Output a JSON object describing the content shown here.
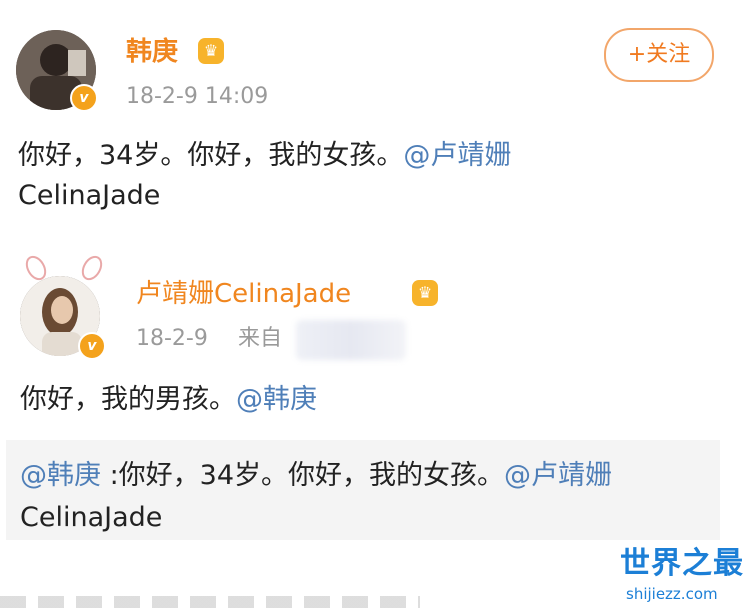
{
  "post": {
    "username": "韩庚",
    "timestamp": "18-2-9 14:09",
    "follow_label": "+关注",
    "text": "你好，34岁。你好，我的女孩。",
    "mention_line1": "@卢靖姗",
    "mention_line2": "CelinaJade"
  },
  "reply": {
    "username": "卢靖姗CelinaJade",
    "timestamp": "18-2-9",
    "source_label": "来自",
    "text": "你好，我的男孩。",
    "mention": "@韩庚"
  },
  "quoted": {
    "author": "@韩庚",
    "text": " :你好，34岁。你好，我的女孩。",
    "mention_line1": "@卢靖姗",
    "mention_line2": "CelinaJade"
  },
  "watermark": {
    "brand": "世界之最",
    "domain": "shijiezz.com"
  },
  "colors": {
    "username_orange": "#f0861f",
    "link_blue": "#4f7fb8",
    "verified_badge": "#f4a21c",
    "quote_background": "#f4f4f4",
    "watermark_blue": "#1c7fd6"
  },
  "icons": [
    "verified-badge-icon",
    "crown-icon",
    "bunny-ears-icon"
  ]
}
